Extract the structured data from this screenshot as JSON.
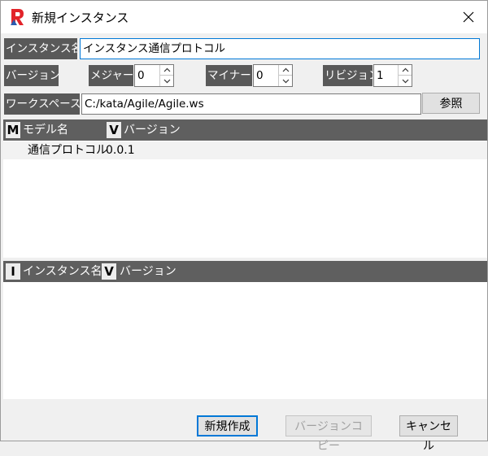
{
  "window": {
    "title": "新規インスタンス",
    "app_icon": "app-logo-icon",
    "close_icon": "close-icon"
  },
  "form": {
    "instance_name_label": "インスタンス名",
    "instance_name_value": "インスタンス通信プロトコル",
    "version_label": "バージョン",
    "major_label": "メジャー",
    "major_value": "0",
    "minor_label": "マイナー",
    "minor_value": "0",
    "revision_label": "リビジョン",
    "revision_value": "1",
    "workspace_label": "ワークスペース",
    "workspace_value": "C:/kata/Agile/Agile.ws",
    "browse_label": "参照"
  },
  "model_table": {
    "col1_icon": "M",
    "col1_label": "モデル名",
    "col2_icon": "V",
    "col2_label": "バージョン",
    "rows": [
      {
        "name": "通信プロトコル",
        "version": "0.0.1"
      }
    ]
  },
  "instance_table": {
    "col1_icon": "I",
    "col1_label": "インスタンス名",
    "col2_icon": "V",
    "col2_label": "バージョン",
    "rows": []
  },
  "footer": {
    "create_label": "新規作成",
    "copy_version_label": "バージョンコピー",
    "cancel_label": "キャンセル"
  },
  "colors": {
    "accent": "#0078d7",
    "label_bg": "#595959",
    "header_bg": "#5f5f5f",
    "logo_red": "#e2242a"
  }
}
